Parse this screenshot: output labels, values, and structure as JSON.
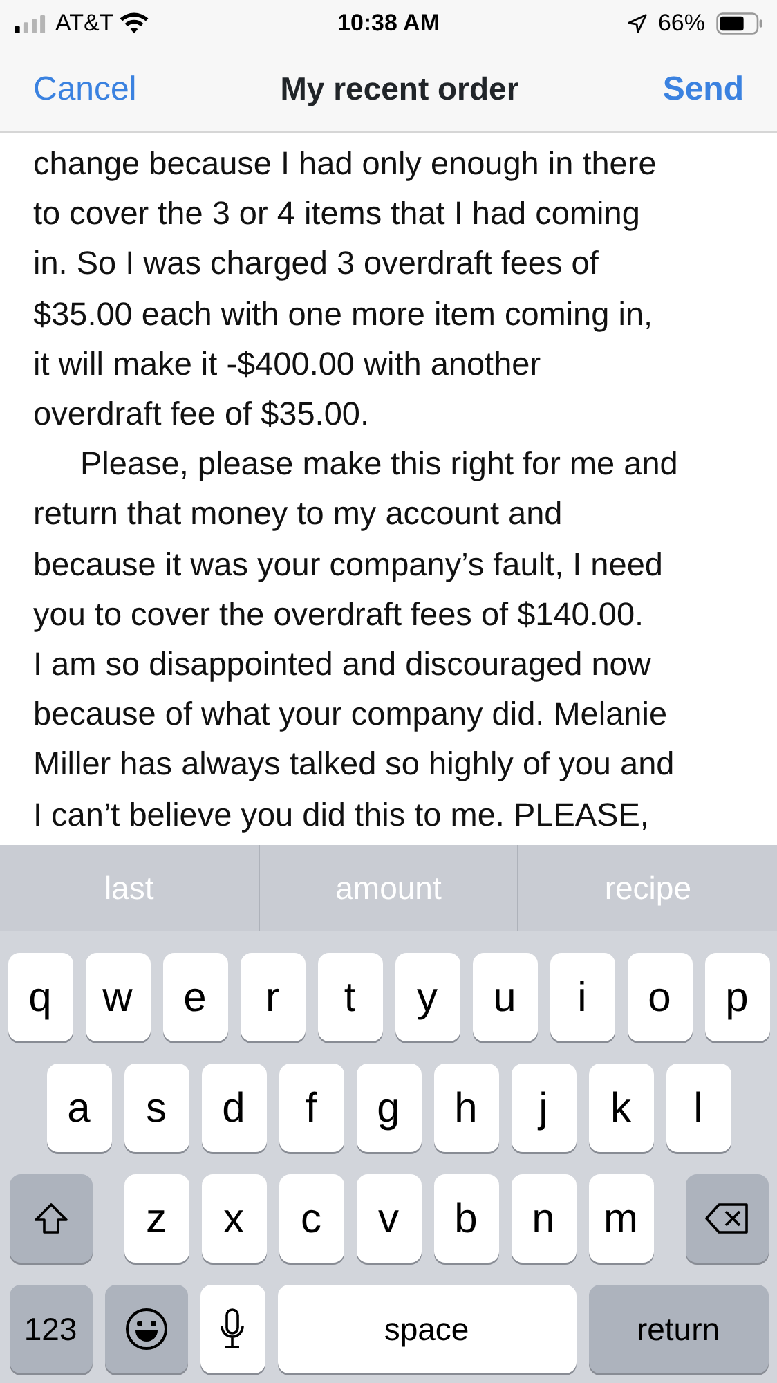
{
  "status_bar": {
    "carrier": "AT&T",
    "time": "10:38 AM",
    "battery": "66%"
  },
  "nav": {
    "cancel": "Cancel",
    "title": "My recent order",
    "send": "Send"
  },
  "paragraphs": [
    {
      "indent": false,
      "lines": [
        "change because I had only enough in there",
        "to cover the 3 or 4 items that I had coming",
        "in. So I was charged 3 overdraft fees of",
        "$35.00 each with one more item coming in,",
        "it will make it  -$400.00 with another",
        "overdraft fee of $35.00."
      ]
    },
    {
      "indent": true,
      "lines": [
        "Please, please make this right for me and",
        "return that money to my account and",
        "because it was your company’s fault, I need",
        "you to cover the overdraft fees of $140.00.",
        "I am so disappointed and discouraged now",
        "because of what your company did. Melanie",
        "Miller has always talked so highly of you and",
        "I can’t believe you did this to me. PLEASE,"
      ]
    }
  ],
  "suggestions": [
    "last",
    "amount",
    "recipe"
  ],
  "keyboard": [
    [
      {
        "kind": "letter",
        "label": "q"
      },
      {
        "kind": "letter",
        "label": "w"
      },
      {
        "kind": "letter",
        "label": "e"
      },
      {
        "kind": "letter",
        "label": "r"
      },
      {
        "kind": "letter",
        "label": "t"
      },
      {
        "kind": "letter",
        "label": "y"
      },
      {
        "kind": "letter",
        "label": "u"
      },
      {
        "kind": "letter",
        "label": "i"
      },
      {
        "kind": "letter",
        "label": "o"
      },
      {
        "kind": "letter",
        "label": "p"
      }
    ],
    [
      {
        "kind": "letter",
        "label": "a"
      },
      {
        "kind": "letter",
        "label": "s"
      },
      {
        "kind": "letter",
        "label": "d"
      },
      {
        "kind": "letter",
        "label": "f"
      },
      {
        "kind": "letter",
        "label": "g"
      },
      {
        "kind": "letter",
        "label": "h"
      },
      {
        "kind": "letter",
        "label": "j"
      },
      {
        "kind": "letter",
        "label": "k"
      },
      {
        "kind": "letter",
        "label": "l"
      }
    ],
    [
      {
        "kind": "shift"
      },
      {
        "kind": "letter",
        "label": "z"
      },
      {
        "kind": "letter",
        "label": "x"
      },
      {
        "kind": "letter",
        "label": "c"
      },
      {
        "kind": "letter",
        "label": "v"
      },
      {
        "kind": "letter",
        "label": "b"
      },
      {
        "kind": "letter",
        "label": "n"
      },
      {
        "kind": "letter",
        "label": "m"
      },
      {
        "kind": "delete"
      }
    ],
    [
      {
        "kind": "numbers",
        "label": "123"
      },
      {
        "kind": "emoji"
      },
      {
        "kind": "mic"
      },
      {
        "kind": "space",
        "label": "space"
      },
      {
        "kind": "return",
        "label": "return"
      }
    ]
  ]
}
